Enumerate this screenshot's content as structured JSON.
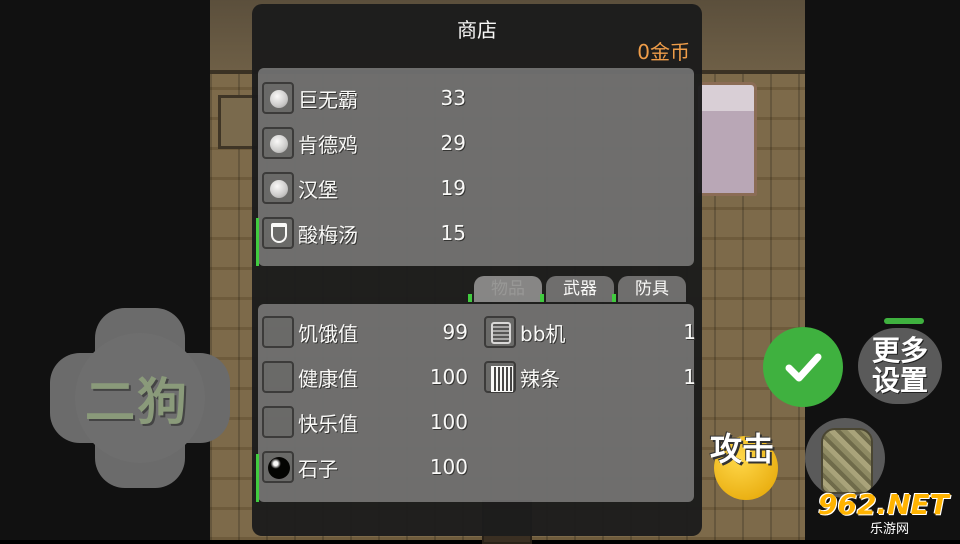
{
  "shop": {
    "title": "商店",
    "gold": "0金币",
    "goods": [
      {
        "name": "巨无霸",
        "price": "33",
        "icon": "pearl-icon"
      },
      {
        "name": "肯德鸡",
        "price": "29",
        "icon": "pearl-icon"
      },
      {
        "name": "汉堡",
        "price": "19",
        "icon": "pearl-icon"
      },
      {
        "name": "酸梅汤",
        "price": "15",
        "icon": "flask-icon"
      }
    ],
    "tabs": [
      "物品",
      "武器",
      "防具"
    ],
    "active_tab": "物品",
    "stats": [
      {
        "name": "饥饿值",
        "value": "99"
      },
      {
        "name": "健康值",
        "value": "100"
      },
      {
        "name": "快乐值",
        "value": "100"
      },
      {
        "name": "石子",
        "value": "100",
        "icon": "stone-icon"
      }
    ],
    "inventory": [
      {
        "name": "bb机",
        "count": "1",
        "icon": "pager-icon"
      },
      {
        "name": "辣条",
        "count": "1",
        "icon": "spicy-strip-icon"
      }
    ]
  },
  "controls": {
    "dpad_label": "二狗",
    "more_settings_line1": "更多",
    "more_settings_line2": "设置",
    "attack_label": "攻击"
  },
  "watermark": {
    "main": "962.NET",
    "sub": "乐游网"
  },
  "colors": {
    "gold_text": "#f5a04a",
    "confirm_green": "#3fb13f",
    "scroll_green": "#3fcf3f"
  }
}
